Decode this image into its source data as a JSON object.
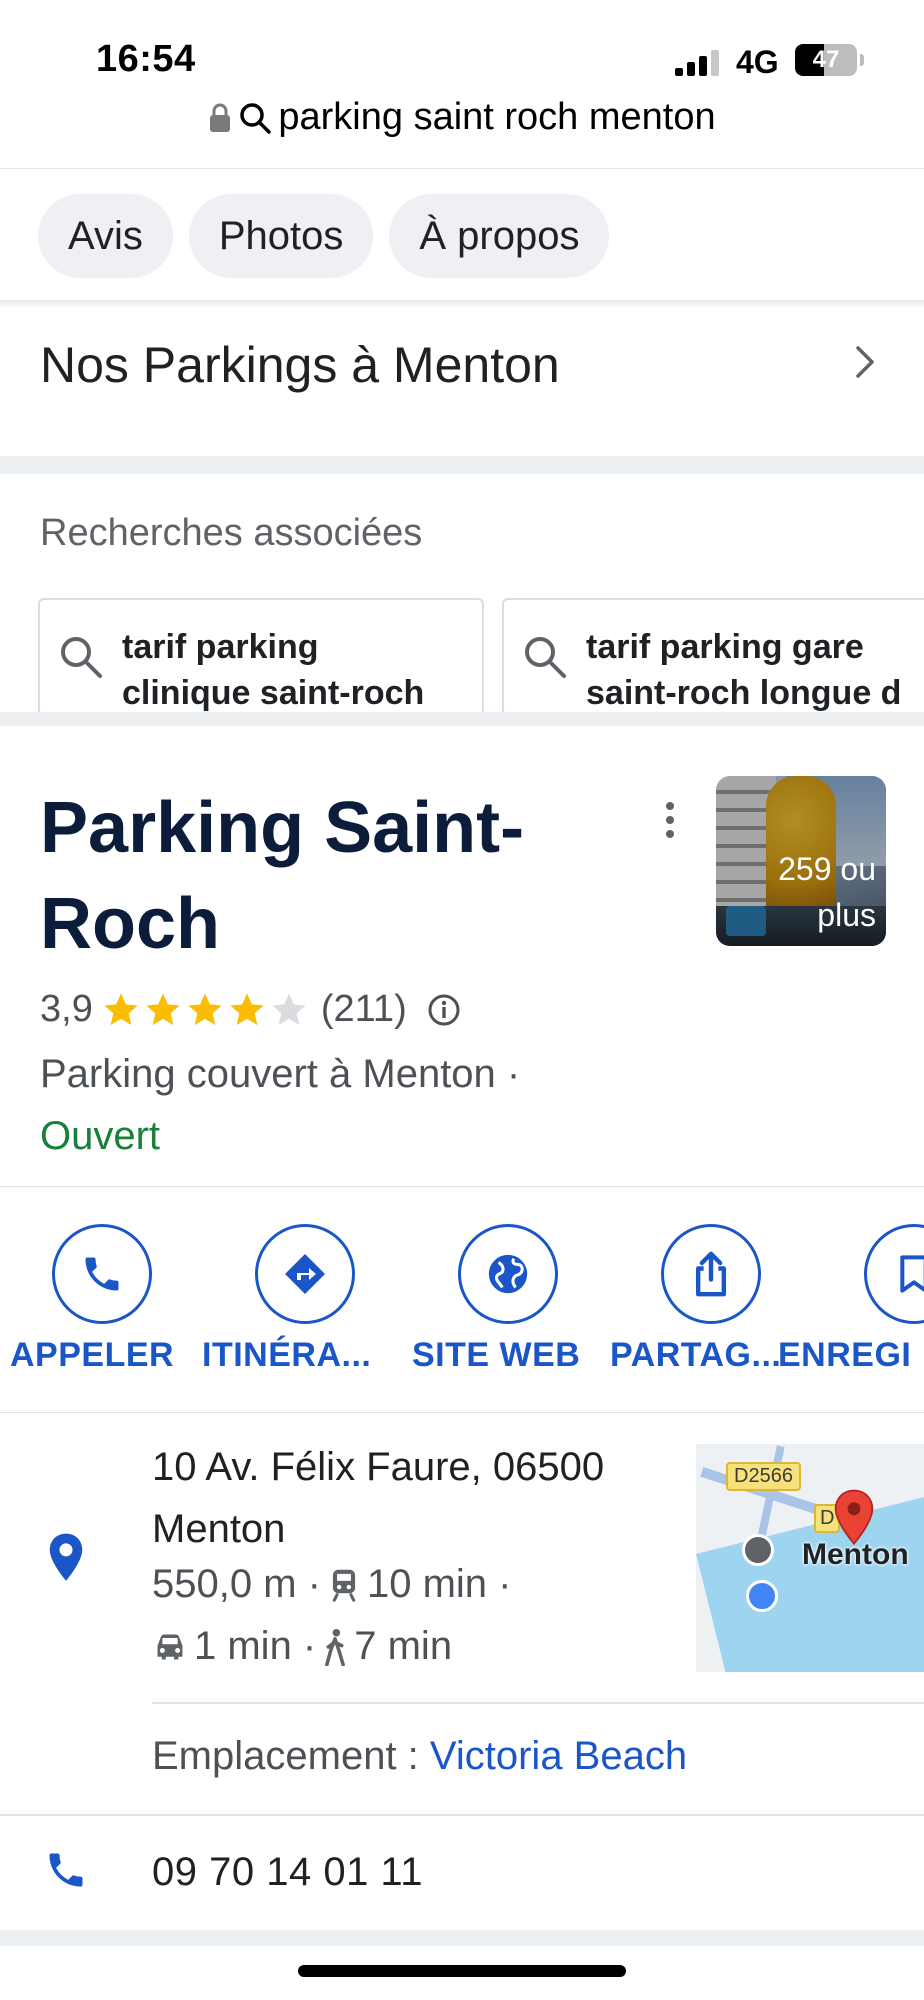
{
  "status_bar": {
    "time": "16:54",
    "network": "4G",
    "battery": "47",
    "battery_level": 0.47
  },
  "browser": {
    "url_text": "parking saint roch menton"
  },
  "tabs": [
    {
      "label": "Avis"
    },
    {
      "label": "Photos"
    },
    {
      "label": "À propos"
    }
  ],
  "link_section": {
    "title": "Nos Parkings à Menton"
  },
  "related": {
    "title": "Recherches associées",
    "items": [
      {
        "text": "tarif parking\nclinique saint-roch"
      },
      {
        "text": "tarif parking gare\nsaint-roch longue d"
      }
    ]
  },
  "place": {
    "name": "Parking Saint-Roch",
    "photo_overlay": "259 ou plus",
    "rating": "3,9",
    "stars_filled": 4,
    "stars_total": 5,
    "review_count": "(211)",
    "category": "Parking couvert à Menton ·",
    "status": "Ouvert"
  },
  "actions": [
    {
      "label": "APPELER",
      "icon": "phone-icon"
    },
    {
      "label": "ITINÉRA...",
      "icon": "directions-icon"
    },
    {
      "label": "SITE WEB",
      "icon": "globe-icon"
    },
    {
      "label": "PARTAG...",
      "icon": "share-icon"
    },
    {
      "label": "ENREGI",
      "icon": "bookmark-icon"
    }
  ],
  "address": {
    "text": "10 Av. Félix Faure, 06500 Menton",
    "distance": "550,0 m ·",
    "transit_time": "10 min ·",
    "drive_time": "1 min ·",
    "walk_time": "7 min"
  },
  "map": {
    "road_label": "D2566",
    "road_label_2": "D",
    "city": "Menton"
  },
  "location": {
    "label": "Emplacement :",
    "value": "Victoria Beach"
  },
  "phone": {
    "number": "09 70 14 01 11"
  },
  "colors": {
    "accent": "#1a56c7",
    "open": "#188038",
    "star": "#fbbc04",
    "star_empty": "#dadce0"
  }
}
